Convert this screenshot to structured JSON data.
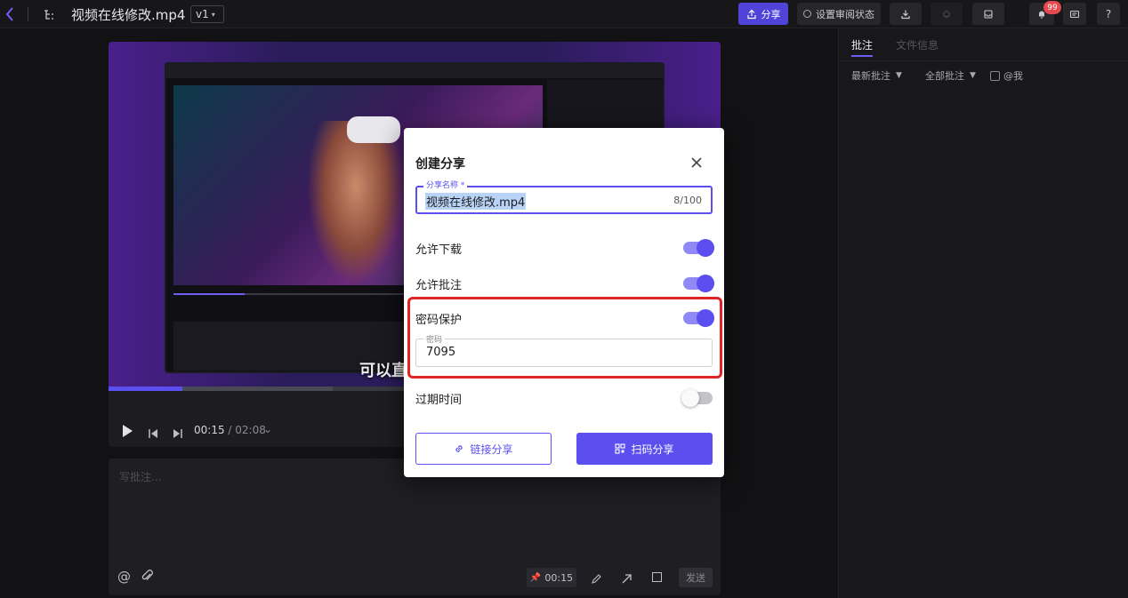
{
  "topbar": {
    "filename": "视频在线修改.mp4",
    "version": "v1",
    "share_label": "分享",
    "review_status_label": "设置审阅状态",
    "notification_count": "99",
    "help_label": "?"
  },
  "sidebar": {
    "tabs": [
      "批注",
      "文件信息"
    ],
    "filters": {
      "sort_label": "最新批注",
      "scope_label": "全部批注",
      "mention_label": "@我"
    }
  },
  "player": {
    "subtitle": "可以直",
    "current_time": "00:15",
    "total_time": "02:08",
    "progress": 0.12
  },
  "comment": {
    "placeholder": "写批注...",
    "timestamp": "00:15",
    "send_label": "发送"
  },
  "modal": {
    "title": "创建分享",
    "name_field": {
      "label": "分享名称 *",
      "value": "视频在线修改.mp4",
      "counter": "8/100"
    },
    "allow_download": {
      "label": "允许下载",
      "on": true
    },
    "allow_comment": {
      "label": "允许批注",
      "on": true
    },
    "password_protect": {
      "label": "密码保护",
      "on": true
    },
    "password_field": {
      "label": "密码",
      "value": "7095"
    },
    "expiry": {
      "label": "过期时间",
      "on": false
    },
    "link_share_label": "链接分享",
    "qr_share_label": "扫码分享"
  },
  "colors": {
    "accent": "#5b4ff0",
    "highlight_box": "#e02424",
    "badge": "#e5484d"
  }
}
